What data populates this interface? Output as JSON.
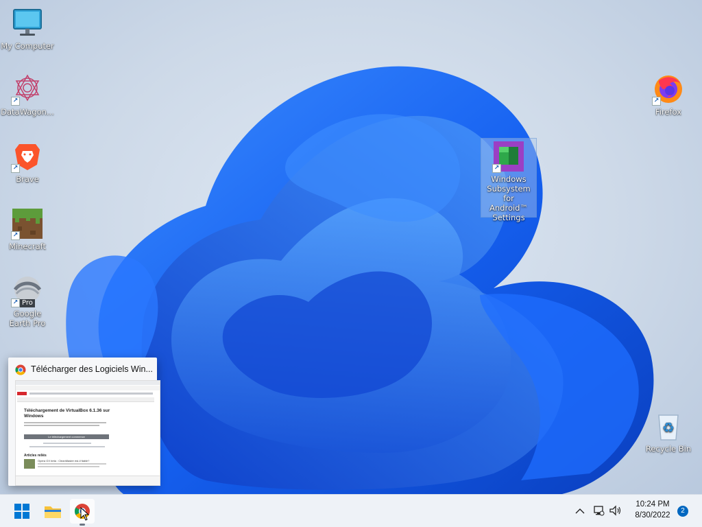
{
  "desktop": {
    "icons": [
      {
        "label": "My Computer",
        "icon": "monitor-icon"
      },
      {
        "label": "DataWagon...",
        "icon": "datawagon-icon"
      },
      {
        "label": "Brave",
        "icon": "brave-lion-icon"
      },
      {
        "label": "Minecraft",
        "icon": "minecraft-grass-block-icon"
      },
      {
        "label": "Google Earth Pro",
        "badge": "Pro",
        "icon": "google-earth-icon"
      },
      {
        "label": "Firefox",
        "icon": "firefox-icon"
      },
      {
        "label": "Windows Subsystem for Android™ Settings",
        "icon": "wsa-settings-icon",
        "selected": true
      },
      {
        "label": "Recycle Bin",
        "icon": "recycle-bin-icon"
      }
    ]
  },
  "preview": {
    "title": "Télécharger des Logiciels Win...",
    "page_heading": "Téléchargement de VirtualBox 6.1.36 sur Windows",
    "download_button": "Le téléchargement commence",
    "related_heading": "Articles reliés",
    "related_item": "Opera GX beta : CleanMaster est-il fiable?"
  },
  "taskbar": {
    "apps": [
      "windows-start-icon",
      "file-explorer-icon",
      "chrome-icon"
    ],
    "time": "10:24 PM",
    "date": "8/30/2022",
    "notification_count": "2"
  },
  "colors": {
    "wallpaper_blue": "#1565e8",
    "taskbar_bg": "#eef2f7",
    "accent": "#0067c0"
  }
}
